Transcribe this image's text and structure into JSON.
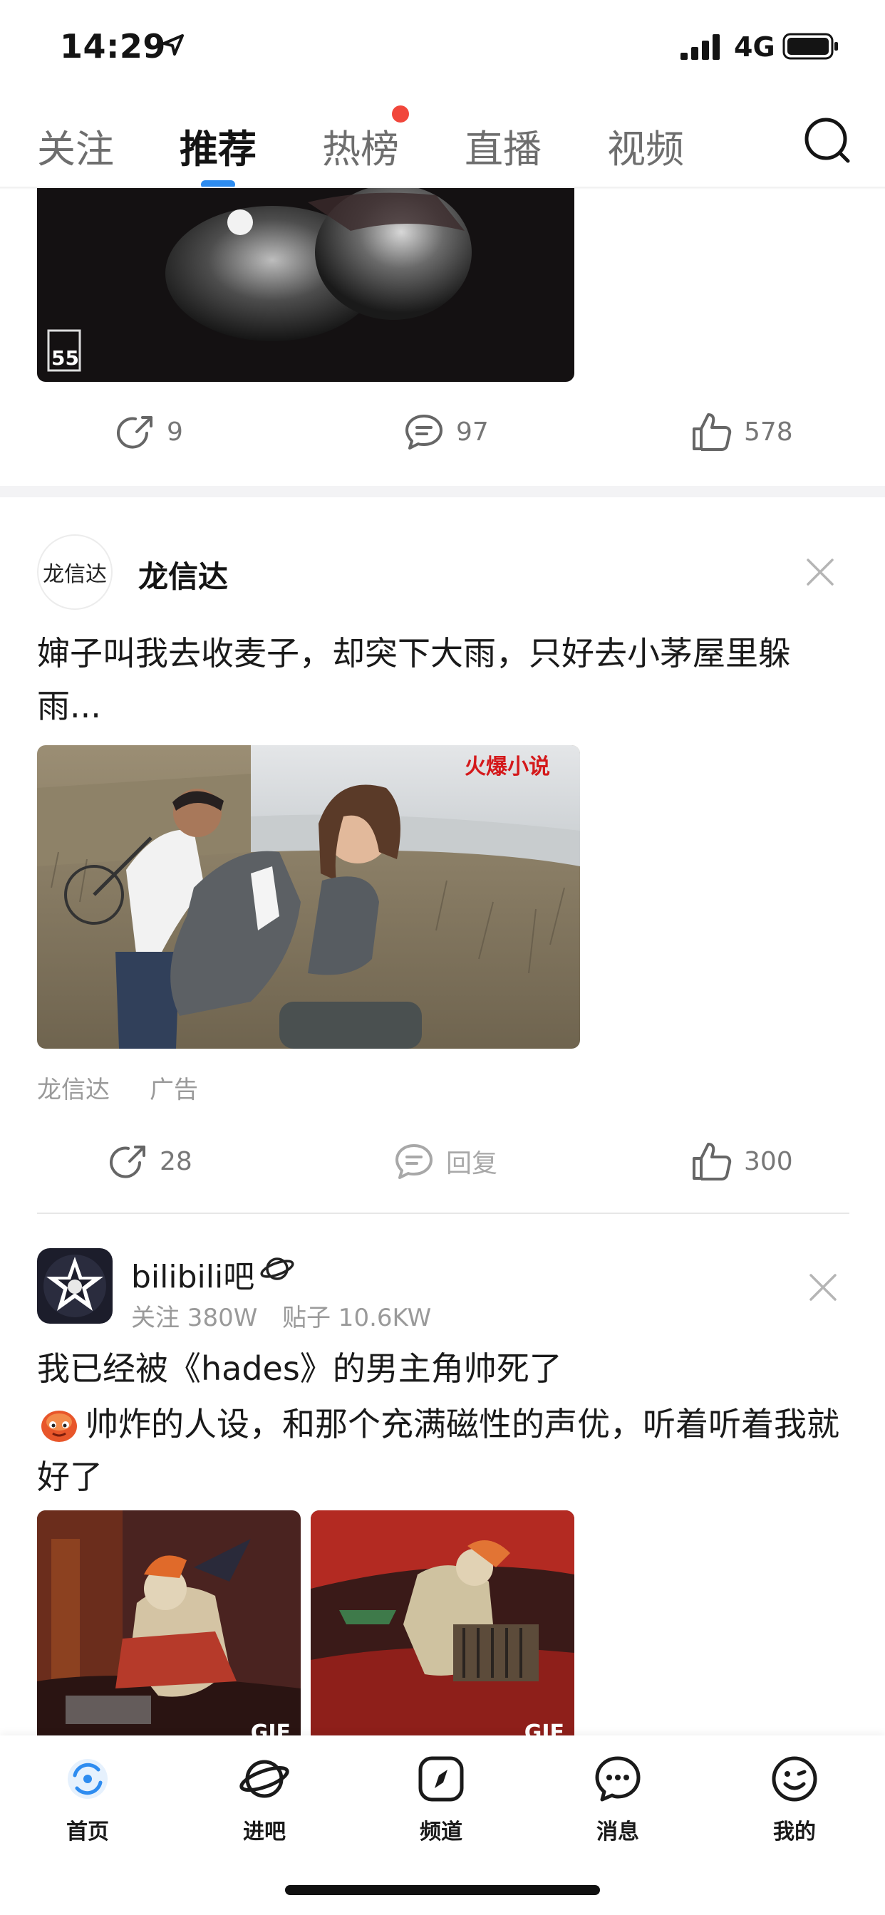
{
  "status_bar": {
    "time": "14:29",
    "network": "4G"
  },
  "tabs": [
    {
      "label": "关注"
    },
    {
      "label": "推荐"
    },
    {
      "label": "热榜"
    },
    {
      "label": "直播"
    },
    {
      "label": "视频"
    }
  ],
  "post_prev": {
    "shares": "9",
    "comments": "97",
    "likes": "578"
  },
  "ad_post": {
    "logo_text": "龙信达",
    "author": "龙信达",
    "title": "婶子叫我去收麦子，却突下大雨，只好去小茅屋里躲雨...",
    "image_watermark": "火爆小说",
    "source": "龙信达",
    "ad_label": "广告",
    "shares": "28",
    "reply": "回复",
    "likes": "300"
  },
  "bar_post": {
    "forum_name": "bilibili吧",
    "followers": "关注 380W",
    "posts": "贴子 10.6KW",
    "title_line1": "我已经被《hades》的男主角帅死了",
    "title_line2": "帅炸的人设，和那个充满磁性的声优，听着听着我就好了",
    "gif_label": "GIF"
  },
  "bottom_nav": [
    {
      "label": "首页"
    },
    {
      "label": "进吧"
    },
    {
      "label": "频道"
    },
    {
      "label": "消息"
    },
    {
      "label": "我的"
    }
  ],
  "colors": {
    "accent_blue": "#2e8cf0",
    "notify_red": "#f1463b",
    "watermark_red": "#d4191b"
  }
}
